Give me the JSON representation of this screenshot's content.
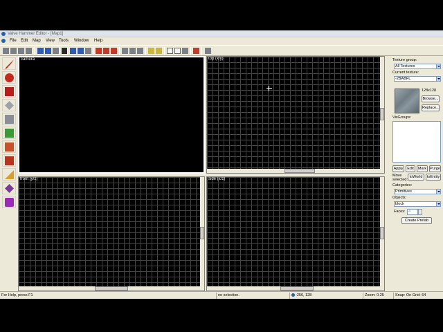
{
  "window": {
    "title": "Valve Hammer Editor - [Map1]"
  },
  "menubar": {
    "items": [
      "File",
      "Edit",
      "Map",
      "View",
      "Tools",
      "Window",
      "Help"
    ]
  },
  "toolbar": {
    "buttons": [
      "select",
      "magnify",
      "camera",
      "entity",
      "block",
      "texture",
      "apply-texture",
      "decal",
      "clip",
      "vertex",
      "path",
      "cordon",
      "group",
      "ungroup",
      "hide",
      "cut",
      "copy",
      "paste",
      "undo",
      "redo",
      "run-map",
      "texture-lock",
      "texture-scale",
      "snap-grid",
      "show-grid",
      "carve",
      "tie-to-entity",
      "move-to-world",
      "help"
    ]
  },
  "tool_palette": {
    "tools": [
      {
        "name": "selection-tool",
        "color": "#c42a1e"
      },
      {
        "name": "magnify-tool",
        "color": "#c42a1e"
      },
      {
        "name": "camera-tool",
        "color": "#b81d1d"
      },
      {
        "name": "entity-tool",
        "color": "#7a7f88"
      },
      {
        "name": "block-tool",
        "color": "#8a8f96"
      },
      {
        "name": "texture-application-tool",
        "color": "#3a9a3a"
      },
      {
        "name": "apply-current-texture-tool",
        "color": "#c9502a"
      },
      {
        "name": "decal-tool",
        "color": "#b8341e"
      },
      {
        "name": "overlay-tool",
        "color": "#d8a030"
      },
      {
        "name": "clipping-tool",
        "color": "#7a3a9a"
      },
      {
        "name": "vertex-manipulation-tool",
        "color": "#9a2ab8"
      }
    ]
  },
  "viewports": {
    "camera": {
      "label": "camera"
    },
    "top": {
      "label": "top (x/y)"
    },
    "front": {
      "label": "front (y/z)"
    },
    "side": {
      "label": "side (x/z)"
    }
  },
  "right_panel": {
    "texture_group_label": "Texture group:",
    "texture_group_value": "All Textures",
    "current_texture_label": "Current texture:",
    "current_texture_value": "-2BABFL",
    "texture_size": "128x128",
    "browse_button": "Browse...",
    "replace_button": "Replace...",
    "visgroups_label": "VisGroups:",
    "apply_button": "Apply",
    "edit_button": "Edit",
    "mark_button": "Mark",
    "purge_button": "Purge",
    "move_selected_label": "Move selected:",
    "to_world_button": "toWorld",
    "to_entity_button": "toEntity",
    "categories_label": "Categories:",
    "categories_value": "Primitives",
    "objects_label": "Objects:",
    "objects_value": "block",
    "faces_label": "Faces:",
    "faces_value": "4",
    "create_prefab_button": "Create Prefab"
  },
  "statusbar": {
    "help_text": "For Help, press F1",
    "selection_text": "no selection.",
    "coords_text": "-256, 128",
    "zoom_text": "Zoom: 0.25",
    "snap_text": "Snap: On Grid: 64"
  }
}
